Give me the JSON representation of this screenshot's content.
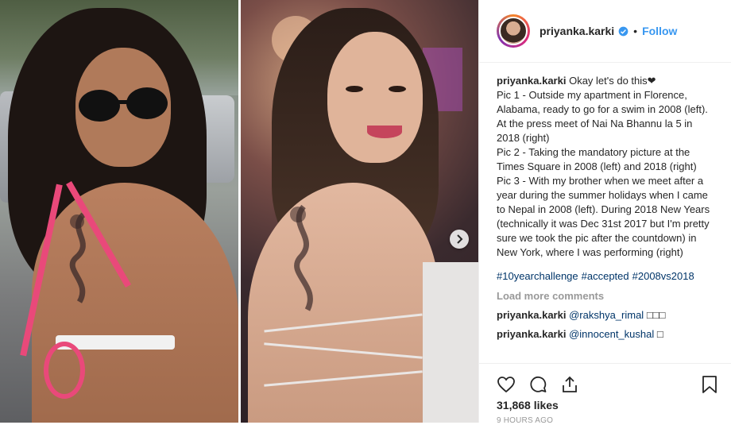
{
  "post": {
    "username": "priyanka.karki",
    "follow_label": "Follow",
    "dot": "•",
    "caption_user": "priyanka.karki",
    "caption_text": "Okay let's do this❤\nPic 1 - Outside my apartment in Florence, Alabama, ready to go for a swim in 2008 (left). At the press meet of Nai Na Bhannu la 5 in 2018 (right)\nPic 2 - Taking the mandatory picture at the Times Square in 2008 (left) and 2018 (right)\nPic 3 - With my brother when we meet after a year during the summer holidays when I came to Nepal in 2008 (left). During 2018 New Years (technically it was Dec 31st 2017 but I'm pretty sure we took the pic after the countdown) in New York, where I was performing (right)",
    "hashtags": [
      "#10yearchallenge",
      "#accepted",
      "#2008vs2018"
    ],
    "load_more": "Load more comments",
    "comments": [
      {
        "user": "priyanka.karki",
        "mention": "@rakshya_rimal",
        "text": "□□□"
      },
      {
        "user": "priyanka.karki",
        "mention": "@innocent_kushal",
        "text": "□"
      }
    ],
    "likes": "31,868 likes",
    "time": "9 HOURS AGO"
  },
  "colors": {
    "link": "#3897f0",
    "hashtag": "#003569",
    "muted": "#999999",
    "text": "#262626"
  },
  "icons": [
    "verified-badge-icon",
    "heart-icon",
    "comment-icon",
    "share-icon",
    "bookmark-icon",
    "chevron-right-icon"
  ]
}
